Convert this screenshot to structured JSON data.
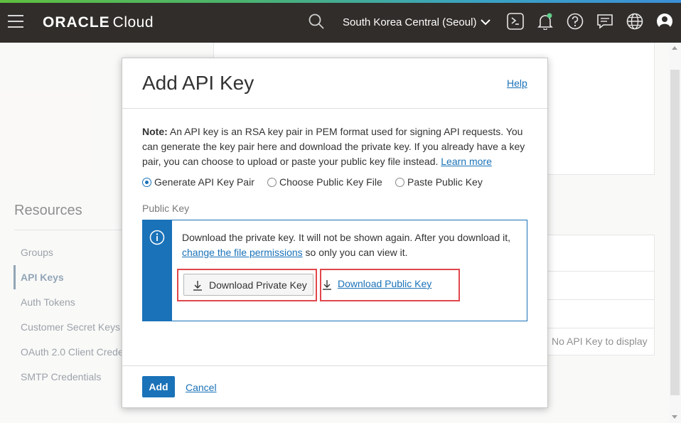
{
  "header": {
    "brand_bold": "ORACLE",
    "brand_light": "Cloud",
    "region": "South Korea Central (Seoul)"
  },
  "icons": {
    "menu": "hamburger-icon",
    "search": "search-icon",
    "region_dropdown": "chevron-down-icon",
    "cloud_shell": "terminal-icon",
    "notifications": "bell-icon",
    "help": "help-icon",
    "feedback": "chat-icon",
    "language": "globe-icon",
    "profile": "user-icon"
  },
  "resources": {
    "title": "Resources",
    "items": [
      {
        "label": "Groups"
      },
      {
        "label": "API Keys",
        "active": true
      },
      {
        "label": "Auth Tokens"
      },
      {
        "label": "Customer Secret Keys"
      },
      {
        "label": "OAuth 2.0 Client Crede"
      },
      {
        "label": "SMTP Credentials"
      }
    ]
  },
  "table": {
    "empty_message": "No API Key to display"
  },
  "modal": {
    "title": "Add API Key",
    "help_link": "Help",
    "note_label": "Note:",
    "note_text": " An API key is an RSA key pair in PEM format used for signing API requests. You can generate the key pair here and download the private key. If you already have a key pair, you can choose to upload or paste your public key file instead. ",
    "learn_more": "Learn more",
    "options": [
      {
        "label": "Generate API Key Pair",
        "selected": true
      },
      {
        "label": "Choose Public Key File",
        "selected": false
      },
      {
        "label": "Paste Public Key",
        "selected": false
      }
    ],
    "public_key_label": "Public Key",
    "info_text_1": "Download the private key. It will not be shown again. After you download it, ",
    "info_link": "change the file permissions",
    "info_text_2": " so only you can view it.",
    "download_private": "Download Private Key",
    "download_public": "Download Public Key",
    "add_button": "Add",
    "cancel_link": "Cancel"
  },
  "colors": {
    "topbar": "#312d2a",
    "accent": "#1a72b8",
    "highlight": "#e0474c"
  }
}
